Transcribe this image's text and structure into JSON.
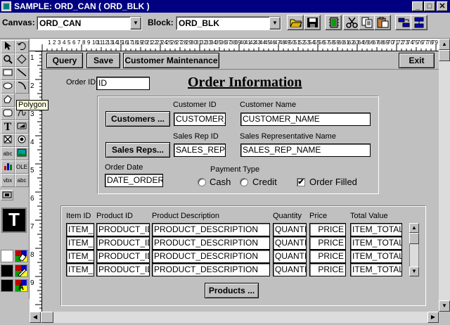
{
  "window": {
    "title": "SAMPLE: ORD_CAN ( ORD_BLK )",
    "min_glyph": "_",
    "max_glyph": "□",
    "close_glyph": "✕"
  },
  "toolbar": {
    "canvas_label": "Canvas:",
    "canvas_value": "ORD_CAN",
    "block_label": "Block:",
    "block_value": "ORD_BLK",
    "dropdown_glyph": "▼"
  },
  "palette": {
    "tooltip": "Polygon",
    "text_glyph": "T",
    "abc": "abc",
    "ole": "OLE",
    "vbx": "vbx"
  },
  "rulers": {
    "h": [
      "1",
      "2",
      "3",
      "4",
      "5",
      "6",
      "7",
      "8",
      "9",
      "10",
      "11",
      "12",
      "13",
      "14",
      "15",
      "16",
      "17",
      "18",
      "19",
      "20",
      "21",
      "22",
      "23",
      "24",
      "25",
      "26",
      "27",
      "28",
      "29",
      "30",
      "31",
      "32",
      "33",
      "34",
      "35",
      "36",
      "37",
      "38",
      "39",
      "40",
      "41",
      "42",
      "43",
      "44",
      "45",
      "46",
      "47",
      "48",
      "49",
      "50",
      "51",
      "52",
      "53",
      "54",
      "55",
      "56",
      "57",
      "58",
      "59",
      "60",
      "61",
      "62",
      "63",
      "64",
      "65",
      "66",
      "67",
      "68",
      "69",
      "70",
      "71",
      "72",
      "73",
      "74",
      "75",
      "76",
      "77",
      "78",
      "79",
      "80",
      "81",
      "82"
    ],
    "v": [
      "1",
      "2",
      "3",
      "4",
      "5",
      "6",
      "7",
      "8",
      "9"
    ]
  },
  "form": {
    "buttons": {
      "query": "Query",
      "save": "Save",
      "customer_maintenance": "Customer Maintenance",
      "exit": "Exit"
    },
    "title": "Order Information",
    "order_id_label": "Order ID",
    "order_id_value": "ID",
    "customer_id_label": "Customer ID",
    "customer_name_label": "Customer Name",
    "customers_button": "Customers ...",
    "customer_id_value": "CUSTOMER_",
    "customer_name_value": "CUSTOMER_NAME",
    "sales_rep_id_label": "Sales Rep ID",
    "sales_rep_name_label": "Sales Representative Name",
    "sales_reps_button": "Sales Reps...",
    "sales_rep_id_value": "SALES_REP_",
    "sales_rep_name_value": "SALES_REP_NAME",
    "order_date_label": "Order Date",
    "order_date_value": "DATE_ORDER",
    "payment_type_label": "Payment Type",
    "cash_label": "Cash",
    "credit_label": "Credit",
    "order_filled_label": "Order Filled",
    "order_filled_checked": true,
    "check_glyph": "✔"
  },
  "items": {
    "headers": [
      "Item ID",
      "Product ID",
      "Product Description",
      "Quantity",
      "Price",
      "Total Value"
    ],
    "rows": [
      [
        "ITEM_I",
        "PRODUCT_ID",
        "PRODUCT_DESCRIPTION",
        "QUANTI",
        "PRICE",
        "ITEM_TOTAL"
      ],
      [
        "ITEM_I",
        "PRODUCT_ID",
        "PRODUCT_DESCRIPTION",
        "QUANTI",
        "PRICE",
        "ITEM_TOTAL"
      ],
      [
        "ITEM_I",
        "PRODUCT_ID",
        "PRODUCT_DESCRIPTION",
        "QUANTI",
        "PRICE",
        "ITEM_TOTAL"
      ],
      [
        "ITEM_I",
        "PRODUCT_ID",
        "PRODUCT_DESCRIPTION",
        "QUANTI",
        "PRICE",
        "ITEM_TOTAL"
      ]
    ],
    "products_button": "Products ...",
    "scroll_up": "▲",
    "scroll_down": "▼"
  },
  "scrollbars": {
    "up": "▲",
    "down": "▼",
    "left": "◀",
    "right": "▶"
  }
}
